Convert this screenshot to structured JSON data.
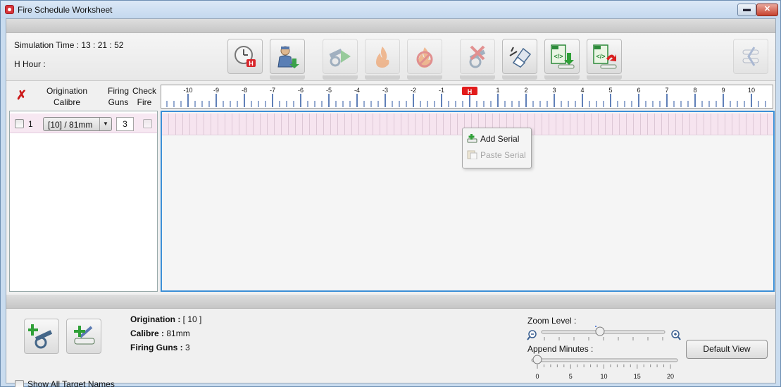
{
  "window": {
    "title": "Fire Schedule Worksheet",
    "minimize_glyph": "▬",
    "close_glyph": "✕"
  },
  "toolbar": {
    "simulation_time_label": "Simulation Time : 13 : 21 : 52",
    "h_hour_label": "H Hour :",
    "buttons": [
      {
        "name": "h-hour-clock-button",
        "icon": "clock-h-icon",
        "enabled": true
      },
      {
        "name": "operator-download-button",
        "icon": "operator-download-icon",
        "enabled": true
      },
      {
        "name": "fire-play-button",
        "icon": "cannon-play-icon",
        "enabled": false
      },
      {
        "name": "fire-button",
        "icon": "flame-icon",
        "enabled": false
      },
      {
        "name": "stop-fire-button",
        "icon": "flame-stop-icon",
        "enabled": false
      },
      {
        "name": "cancel-fire-button",
        "icon": "cannon-cross-icon",
        "enabled": false
      },
      {
        "name": "erase-button",
        "icon": "eraser-icon",
        "enabled": true
      },
      {
        "name": "import-xml-button",
        "icon": "xml-import-icon",
        "enabled": true
      },
      {
        "name": "export-xml-button",
        "icon": "xml-export-icon",
        "enabled": true
      },
      {
        "name": "layout-button",
        "icon": "layout-icon",
        "enabled": false
      }
    ]
  },
  "columns": {
    "origination": "Origination",
    "calibre": "Calibre",
    "firing": "Firing",
    "guns": "Guns",
    "check": "Check",
    "fire": "Fire"
  },
  "ruler": {
    "labels": [
      "-10",
      "-9",
      "-8",
      "-7",
      "-6",
      "-5",
      "-4",
      "-3",
      "-2",
      "-1",
      "H",
      "1",
      "2",
      "3",
      "4",
      "5",
      "6",
      "7",
      "8",
      "9",
      "10"
    ]
  },
  "rows": [
    {
      "number": "1",
      "origination_calibre": "[10] / 81mm",
      "firing_guns": "3",
      "selected": false,
      "check_fire": false
    }
  ],
  "context_menu": {
    "items": [
      {
        "label": "Add Serial",
        "enabled": true
      },
      {
        "label": "Paste Serial",
        "enabled": false
      }
    ]
  },
  "details": {
    "origination_label": "Origination :",
    "origination_value": "[ 10 ]",
    "calibre_label": "Calibre :",
    "calibre_value": "81mm",
    "firing_guns_label": "Firing Guns :",
    "firing_guns_value": "3"
  },
  "bottom": {
    "show_all_target_names": "Show All Target Names",
    "zoom_level_label": "Zoom Level :",
    "append_minutes_label": "Append Minutes :",
    "append_ticks": [
      "0",
      "5",
      "10",
      "15",
      "20"
    ],
    "default_view_button": "Default View",
    "zoom_level_fraction": 0.47,
    "append_minutes_value": 0
  },
  "colors": {
    "accent": "#3c8fd7",
    "row_pink": "#f6e4ef",
    "h_marker": "#e21b1b"
  }
}
